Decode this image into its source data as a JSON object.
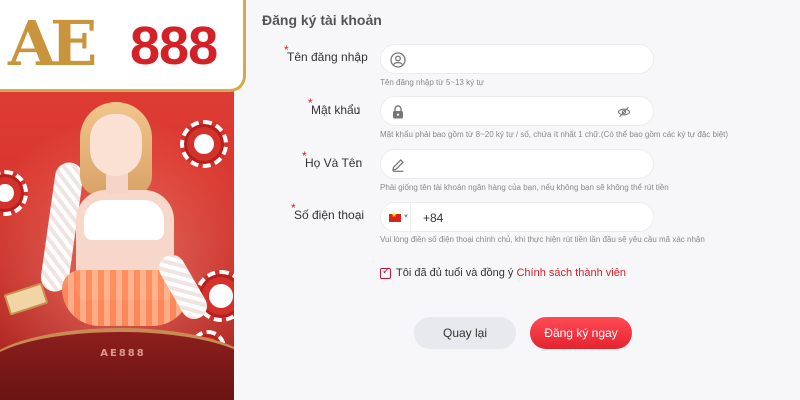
{
  "brand": {
    "logo_letters": "AE",
    "logo_number": "888"
  },
  "promo": {
    "table_text": "AE888"
  },
  "form": {
    "title": "Đăng ký tài khoản",
    "required_mark": "*",
    "colon": ":",
    "username": {
      "label": "Tên đăng nhập",
      "value": "",
      "hint": "Tên đăng nhập từ 5~13 ký tự"
    },
    "password": {
      "label": "Mật khẩu",
      "value": "",
      "hint": "Mật khẩu phải bao gồm từ 8~20 ký tự / số, chứa ít nhất 1 chữ.(Có thể bao gồm các ký tự đặc biệt)"
    },
    "fullname": {
      "label": "Họ Và Tên",
      "value": "",
      "hint": "Phải giống tên tài khoản ngân hàng của bạn, nếu không bạn sẽ không thể rút tiền"
    },
    "phone": {
      "label": "Số điện thoại",
      "country_code": "+84",
      "value": "",
      "hint": "Vui lòng điền số điện thoại chính chủ, khi thực hiện rút tiền lần đầu sẽ yêu cầu mã xác nhận"
    },
    "agree": {
      "checked": true,
      "text": "Tôi đã đủ tuổi và đồng ý ",
      "link": "Chính sách thành viên"
    },
    "back_button": "Quay lại",
    "submit_button": "Đăng ký ngay"
  },
  "colors": {
    "accent": "#d42127",
    "gold": "#c9943c",
    "background": "#f7f7f9"
  }
}
